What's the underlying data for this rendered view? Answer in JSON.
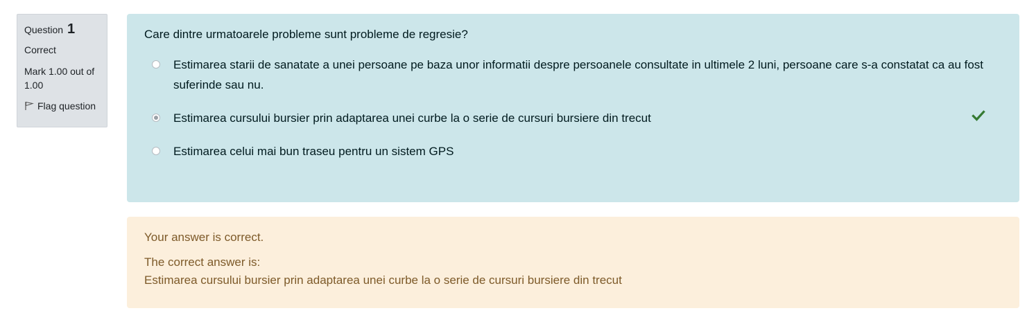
{
  "info": {
    "question_label": "Question",
    "question_number": "1",
    "state": "Correct",
    "grade": "Mark 1.00 out of 1.00",
    "flag_label": "Flag question"
  },
  "question": {
    "text": "Care dintre urmatoarele probleme sunt probleme de regresie?",
    "options": [
      {
        "label": "Estimarea starii de sanatate a unei persoane pe baza unor informatii despre persoanele consultate in ultimele 2 luni, persoane care s-a constatat ca au fost suferinde sau nu.",
        "selected": false
      },
      {
        "label": "Estimarea cursului bursier prin adaptarea unei curbe la o serie de cursuri bursiere din trecut",
        "selected": true,
        "correct_icon": "check-icon"
      },
      {
        "label": "Estimarea celui mai bun traseu pentru un sistem GPS",
        "selected": false
      }
    ]
  },
  "outcome": {
    "feedback": "Your answer is correct.",
    "right_answer_title": "The correct answer is:",
    "right_answer": "Estimarea cursului bursier prin adaptarea unei curbe la o serie de cursuri bursiere din trecut"
  },
  "colors": {
    "info_bg": "#dee2e6",
    "formulation_bg": "#cce6ea",
    "outcome_bg": "#fcefdc",
    "outcome_text": "#7d5a29",
    "check_green": "#357a32"
  }
}
